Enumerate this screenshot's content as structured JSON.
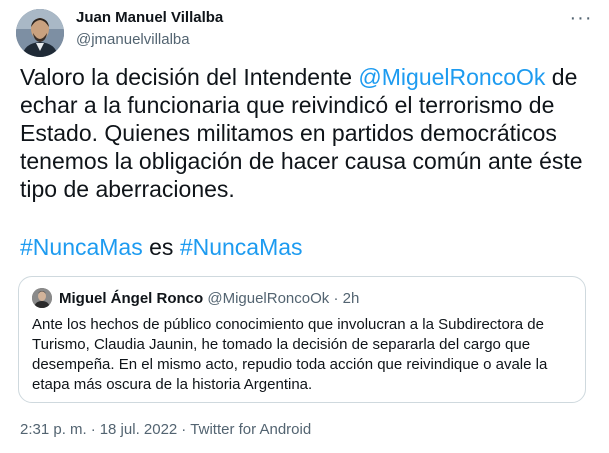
{
  "author": {
    "name": "Juan Manuel Villalba",
    "handle": "@jmanuelvillalba"
  },
  "more_menu_glyph": "···",
  "tweet": {
    "text_before_mention": "Valoro la decisión del Intendente ",
    "mention": "@MiguelRoncoOk",
    "text_after_mention": " de echar a la funcionaria que reivindicó el terrorismo de Estado. Quienes militamos en partidos democráticos tenemos la obligación de hacer causa común ante éste tipo de aberraciones.",
    "hashtag_1": "#NuncaMas",
    "hashtag_joiner": " es ",
    "hashtag_2": "#NuncaMas"
  },
  "quoted_tweet": {
    "name": "Miguel Ángel Ronco",
    "handle": "@MiguelRoncoOk",
    "separator": " · ",
    "time": "2h",
    "text": "Ante los hechos de público conocimiento que involucran a la Subdirectora de Turismo, Claudia Jaunin, he tomado la decisión de separarla del cargo que desempeña. En el mismo acto, repudio toda acción que reivindique o avale la etapa más oscura de la historia Argentina."
  },
  "meta": {
    "time": "2:31 p. m.",
    "separator": "·",
    "date": "18 jul. 2022",
    "source": "Twitter for Android"
  },
  "colors": {
    "link": "#1d9bf0",
    "secondary_text": "#536471",
    "border": "#cfd9de"
  }
}
